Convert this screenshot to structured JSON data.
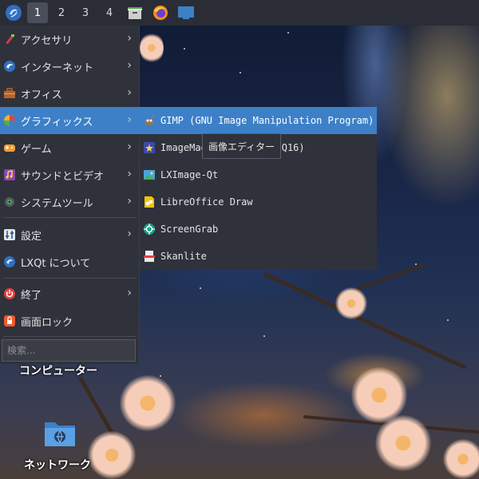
{
  "taskbar": {
    "desktops": [
      "1",
      "2",
      "3",
      "4"
    ],
    "active_desktop": "1",
    "launchers": [
      "file-manager-icon",
      "firefox-icon",
      "desktop-icon"
    ]
  },
  "menu": {
    "items": [
      {
        "label": "アクセサリ",
        "icon": "accessories-icon",
        "has_submenu": true
      },
      {
        "label": "インターネット",
        "icon": "internet-icon",
        "has_submenu": true
      },
      {
        "label": "オフィス",
        "icon": "office-icon",
        "has_submenu": true
      },
      {
        "label": "グラフィックス",
        "icon": "graphics-icon",
        "has_submenu": true,
        "selected": true
      },
      {
        "label": "ゲーム",
        "icon": "games-icon",
        "has_submenu": true
      },
      {
        "label": "サウンドとビデオ",
        "icon": "multimedia-icon",
        "has_submenu": true
      },
      {
        "label": "システムツール",
        "icon": "system-tools-icon",
        "has_submenu": true
      },
      {
        "label": "設定",
        "icon": "settings-icon",
        "has_submenu": true
      },
      {
        "label": "LXQt について",
        "icon": "lxqt-icon",
        "has_submenu": false
      },
      {
        "label": "終了",
        "icon": "power-icon",
        "has_submenu": true
      },
      {
        "label": "画面ロック",
        "icon": "lock-icon",
        "has_submenu": false
      }
    ],
    "search_placeholder": "検索..."
  },
  "submenu": {
    "items": [
      {
        "label": "GIMP (GNU Image Manipulation Program)",
        "icon": "gimp-icon",
        "selected": true
      },
      {
        "label": "ImageMagick (display Q16)",
        "icon": "imagemagick-icon"
      },
      {
        "label": "LXImage-Qt",
        "icon": "image-viewer-icon"
      },
      {
        "label": "LibreOffice Draw",
        "icon": "libreoffice-draw-icon"
      },
      {
        "label": "ScreenGrab",
        "icon": "screengrab-icon"
      },
      {
        "label": "Skanlite",
        "icon": "scanner-icon"
      }
    ]
  },
  "tooltip": {
    "text": "画像エディター"
  },
  "desktop": {
    "computer_label": "コンピューター",
    "network_label": "ネットワーク"
  },
  "colors": {
    "menu_bg": "#2f323a",
    "selection": "#3d80c8",
    "taskbar_bg": "#2a2d36"
  }
}
